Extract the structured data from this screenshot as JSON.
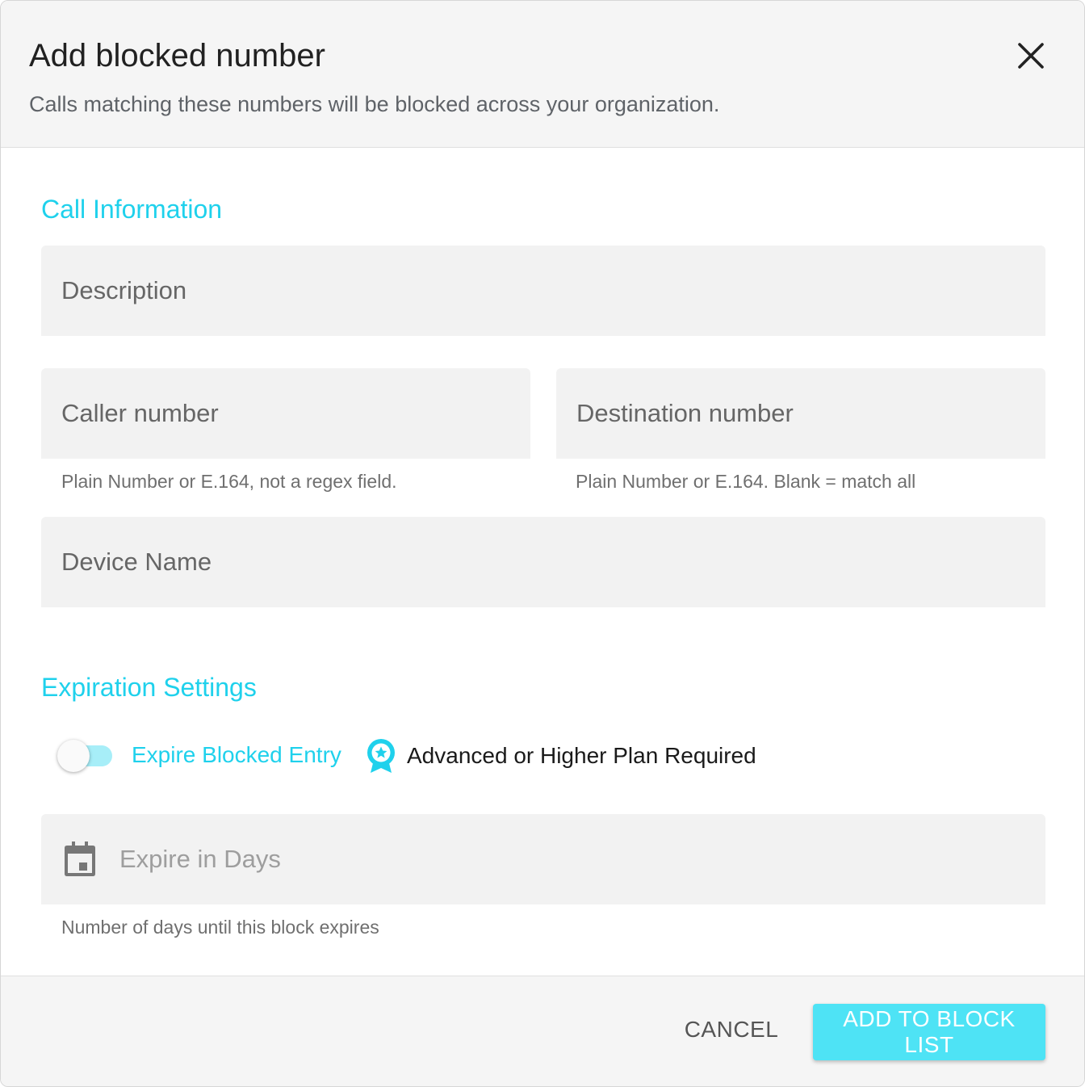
{
  "dialog": {
    "title": "Add blocked number",
    "subtitle": "Calls matching these numbers will be blocked across your organization.",
    "close_icon": "close-icon"
  },
  "call_information": {
    "section_title": "Call Information",
    "description": {
      "value": "",
      "placeholder": "Description"
    },
    "caller_number": {
      "value": "",
      "placeholder": "Caller number",
      "helper": "Plain Number or E.164, not a regex field."
    },
    "destination_number": {
      "value": "",
      "placeholder": "Destination number",
      "helper": "Plain Number or E.164. Blank = match all"
    },
    "device_name": {
      "value": "",
      "placeholder": "Device Name"
    }
  },
  "expiration_settings": {
    "section_title": "Expiration Settings",
    "expire_toggle": {
      "label": "Expire Blocked Entry",
      "on": false
    },
    "plan_badge": {
      "icon": "award-badge-icon",
      "text": "Advanced or Higher Plan Required"
    },
    "expire_days": {
      "value": "",
      "placeholder": "Expire in Days",
      "icon": "calendar-icon",
      "helper": "Number of days until this block expires"
    }
  },
  "footer": {
    "cancel_label": "CANCEL",
    "submit_label": "ADD TO BLOCK LIST"
  },
  "colors": {
    "accent": "#1fd1ec",
    "primary_button": "#4ee3f5",
    "toggle_track": "#a7eef8",
    "field_background": "#f2f2f2",
    "header_background": "#f5f5f5"
  }
}
